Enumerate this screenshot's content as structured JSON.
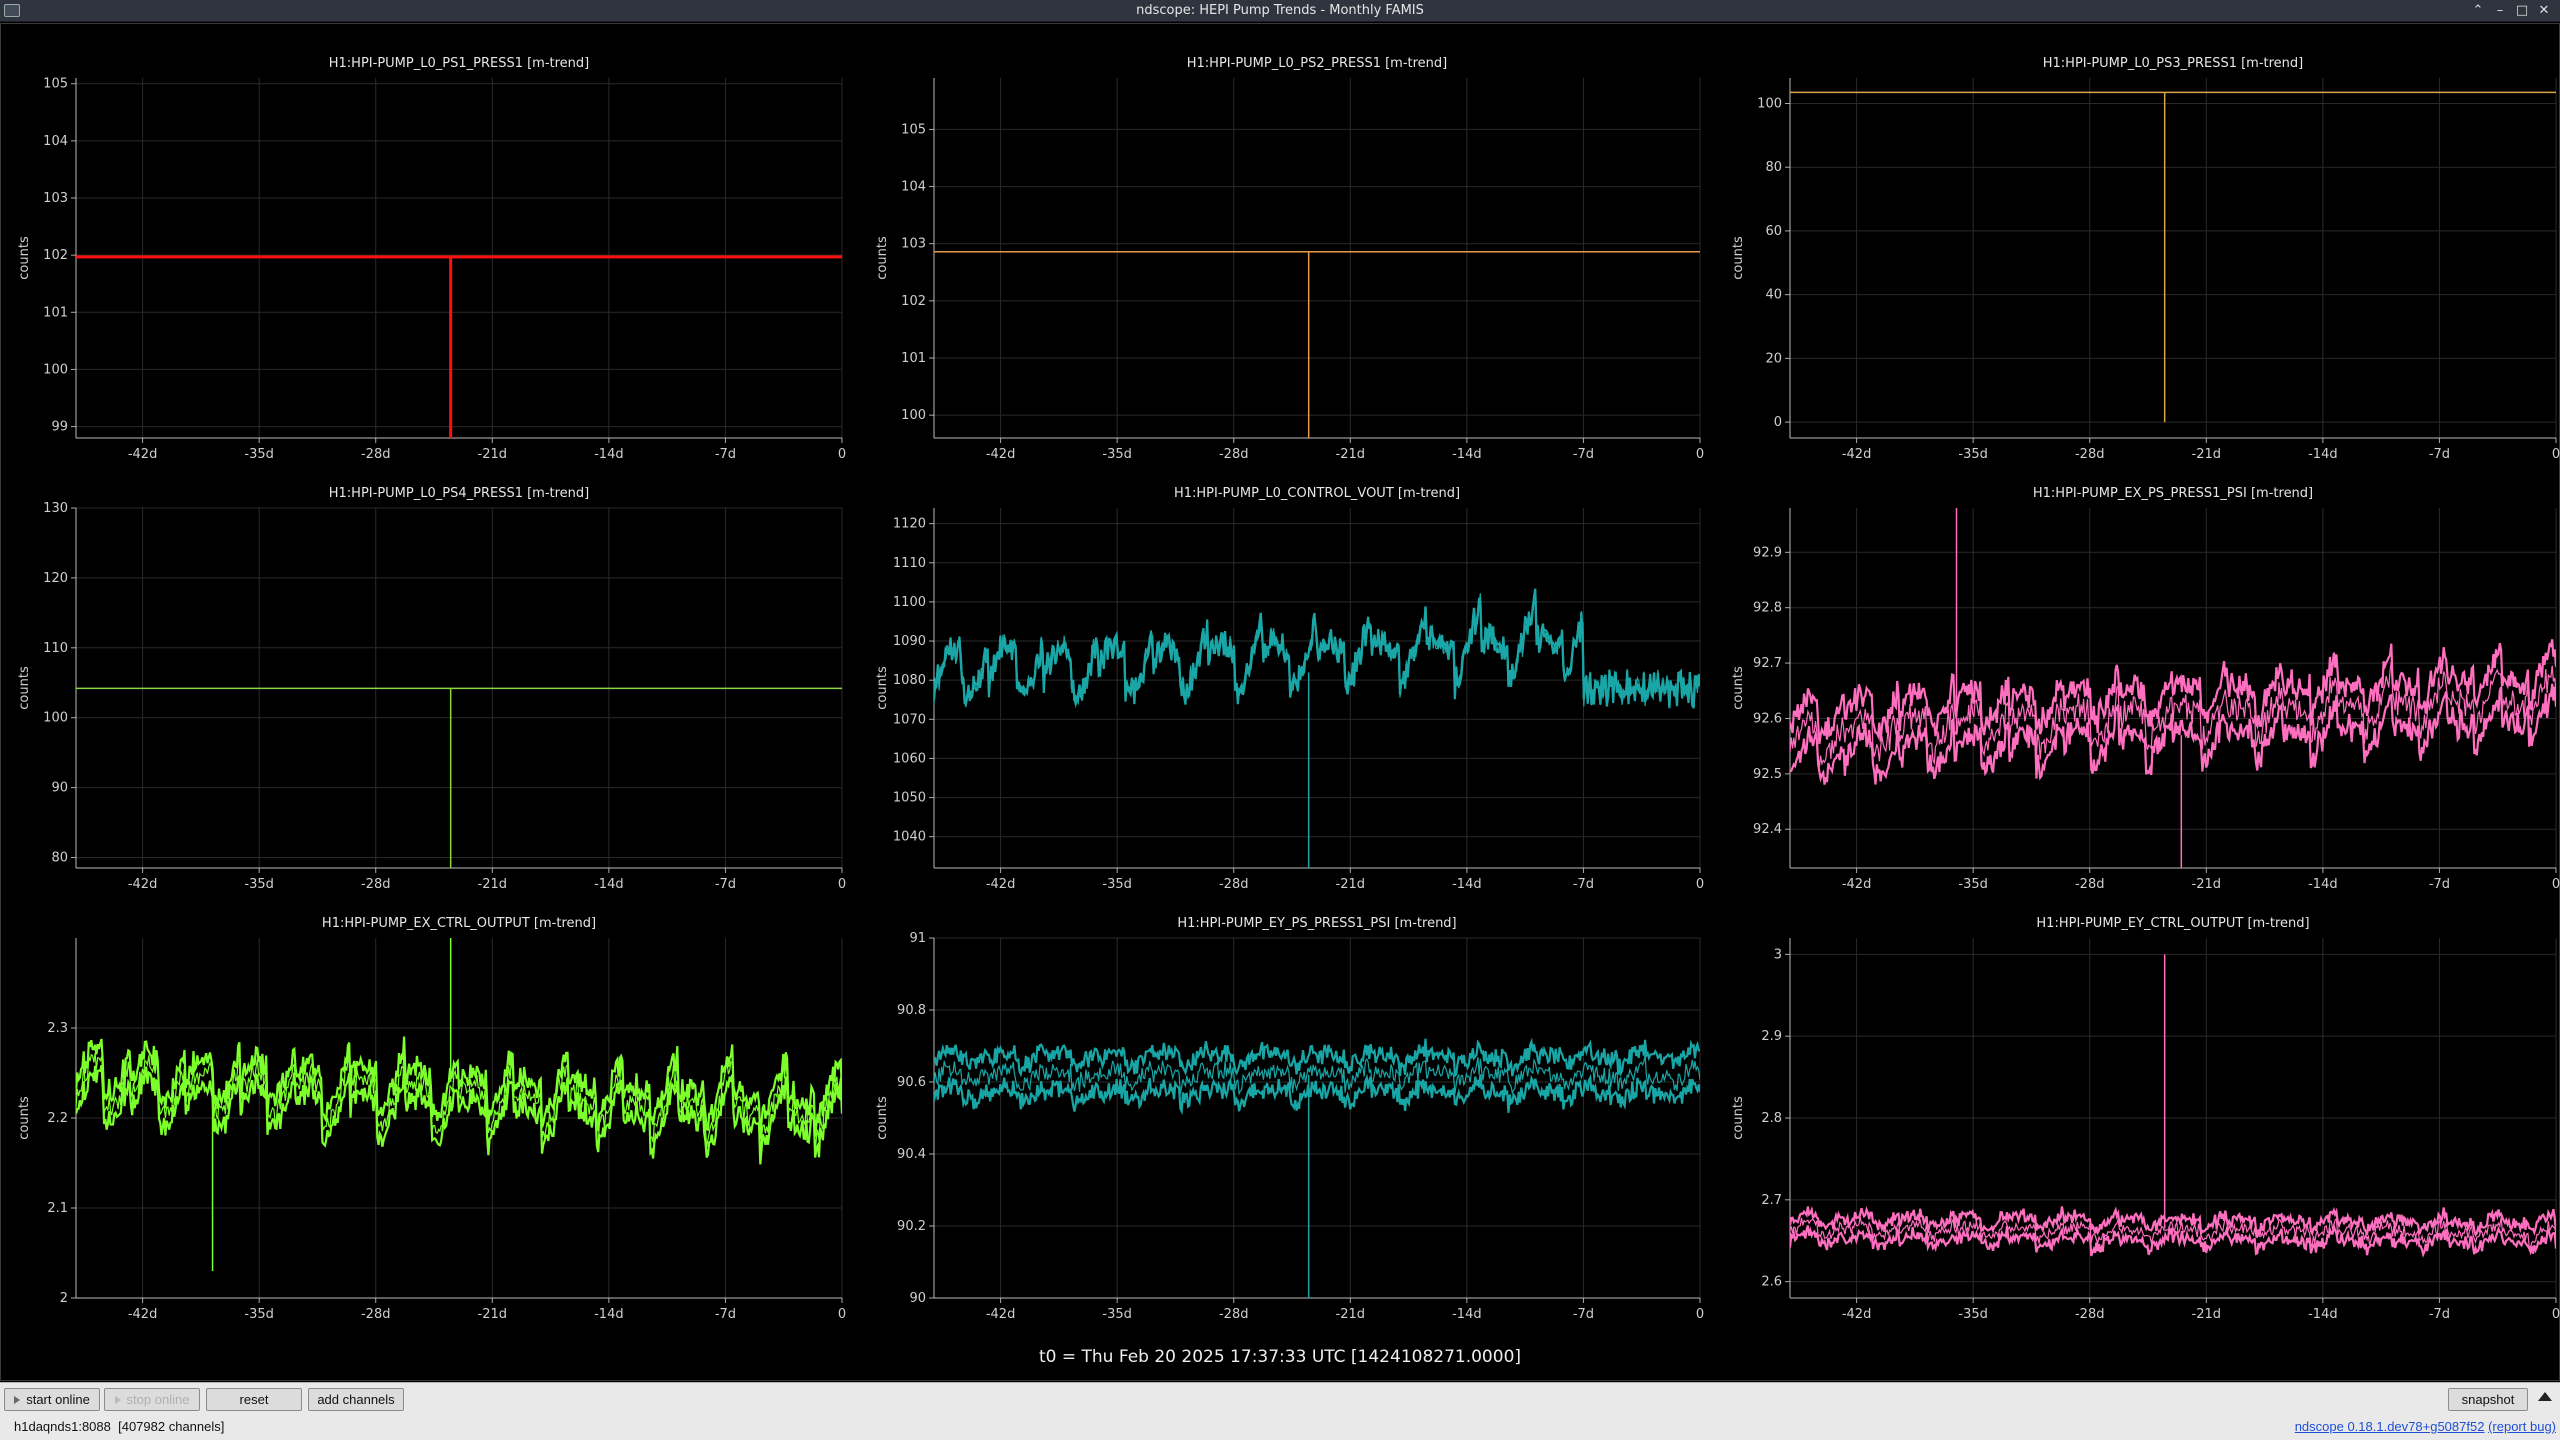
{
  "window": {
    "title": "ndscope: HEPI Pump Trends - Monthly FAMIS"
  },
  "t0_label": "t0 = Thu Feb 20 2025 17:37:33 UTC [1424108271.0000]",
  "controls": {
    "start_online": "start online",
    "stop_online": "stop online",
    "reset": "reset",
    "add_channels": "add channels",
    "snapshot": "snapshot"
  },
  "status": {
    "server": "h1daqnds1:8088",
    "channels": "[407982 channels]",
    "version": "ndscope 0.18.1.dev78+g5087f52",
    "report_bug": "(report bug)"
  },
  "chart_data": [
    {
      "type": "line",
      "title": "H1:HPI-PUMP_L0_PS1_PRESS1 [m-trend]",
      "ylabel": "counts",
      "xlim": [
        -46,
        0
      ],
      "ylim": [
        98.8,
        105.1
      ],
      "x_ticks": [
        "-42d",
        "-35d",
        "-28d",
        "-21d",
        "-14d",
        "-7d",
        "0"
      ],
      "y_ticks": [
        99,
        100,
        101,
        102,
        103,
        104,
        105
      ],
      "color": "#ff1010",
      "pattern": "flat",
      "level": 101.97,
      "dip_x": -23.5,
      "dip_to": 98.8
    },
    {
      "type": "line",
      "title": "H1:HPI-PUMP_L0_PS2_PRESS1 [m-trend]",
      "ylabel": "counts",
      "xlim": [
        -46,
        0
      ],
      "ylim": [
        99.6,
        105.9
      ],
      "x_ticks": [
        "-42d",
        "-35d",
        "-28d",
        "-21d",
        "-14d",
        "-7d",
        "0"
      ],
      "y_ticks": [
        100,
        101,
        102,
        103,
        104,
        105
      ],
      "color": "#e89a4a",
      "pattern": "flat",
      "level": 102.86,
      "dip_x": -23.5,
      "dip_to": 99.6
    },
    {
      "type": "line",
      "title": "H1:HPI-PUMP_L0_PS3_PRESS1 [m-trend]",
      "ylabel": "counts",
      "xlim": [
        -46,
        0
      ],
      "ylim": [
        -5,
        108
      ],
      "x_ticks": [
        "-42d",
        "-35d",
        "-28d",
        "-21d",
        "-14d",
        "-7d",
        "0"
      ],
      "y_ticks": [
        0,
        20,
        40,
        60,
        80,
        100
      ],
      "color": "#d9a64c",
      "pattern": "flat",
      "level": 103.5,
      "dip_x": -23.5,
      "dip_to": 0
    },
    {
      "type": "line",
      "title": "H1:HPI-PUMP_L0_PS4_PRESS1 [m-trend]",
      "ylabel": "counts",
      "xlim": [
        -46,
        0
      ],
      "ylim": [
        78.5,
        130
      ],
      "x_ticks": [
        "-42d",
        "-35d",
        "-28d",
        "-21d",
        "-14d",
        "-7d",
        "0"
      ],
      "y_ticks": [
        80,
        90,
        100,
        110,
        120,
        130
      ],
      "color": "#8ed63f",
      "pattern": "flat",
      "level": 104.2,
      "dip_x": -23.5,
      "dip_to": 78.5
    },
    {
      "type": "line",
      "title": "H1:HPI-PUMP_L0_CONTROL_VOUT [m-trend]",
      "ylabel": "counts",
      "xlim": [
        -46,
        0
      ],
      "ylim": [
        1032,
        1124
      ],
      "x_ticks": [
        "-42d",
        "-35d",
        "-28d",
        "-21d",
        "-14d",
        "-7d",
        "0"
      ],
      "y_ticks": [
        1040,
        1050,
        1060,
        1070,
        1080,
        1090,
        1100,
        1110,
        1120
      ],
      "color": "#1aa6a6",
      "pattern": "noisy",
      "base": 1082,
      "amp": 10,
      "spread": 3,
      "trend": 10,
      "drop_at": -7,
      "drop_to": 1078,
      "dip_x": -23.5,
      "dip_to": 1032,
      "band_offset": 0
    },
    {
      "type": "line",
      "title": "H1:HPI-PUMP_EX_PS_PRESS1_PSI [m-trend]",
      "ylabel": "counts",
      "xlim": [
        -46,
        0
      ],
      "ylim": [
        92.33,
        92.98
      ],
      "x_ticks": [
        "-42d",
        "-35d",
        "-28d",
        "-21d",
        "-14d",
        "-7d",
        "0"
      ],
      "y_ticks": [
        92.4,
        92.5,
        92.6,
        92.7,
        92.8,
        92.9
      ],
      "color": "#ff6fbf",
      "pattern": "noisy",
      "base": 92.57,
      "amp": 0.05,
      "spread": 0.035,
      "trend": 0.07,
      "dip_x": -22.5,
      "dip_to": 92.33,
      "spike_x": -36,
      "spike_to": 92.98,
      "band_offset": 0.04
    },
    {
      "type": "line",
      "title": "H1:HPI-PUMP_EX_CTRL_OUTPUT [m-trend]",
      "ylabel": "counts",
      "xlim": [
        -46,
        0
      ],
      "ylim": [
        2.0,
        2.4
      ],
      "x_ticks": [
        "-42d",
        "-35d",
        "-28d",
        "-21d",
        "-14d",
        "-7d",
        "0"
      ],
      "y_ticks": [
        2.0,
        2.1,
        2.2,
        2.3
      ],
      "color": "#7cff2b",
      "pattern": "noisy",
      "base": 2.24,
      "amp": 0.04,
      "spread": 0.012,
      "trend": -0.03,
      "dip_x": -37.8,
      "dip_to": 2.03,
      "spike_x": -23.5,
      "spike_to": 2.4,
      "band_offset": 0.015
    },
    {
      "type": "line",
      "title": "H1:HPI-PUMP_EY_PS_PRESS1_PSI [m-trend]",
      "ylabel": "counts",
      "xlim": [
        -46,
        0
      ],
      "ylim": [
        90.0,
        91.0
      ],
      "x_ticks": [
        "-42d",
        "-35d",
        "-28d",
        "-21d",
        "-14d",
        "-7d",
        "0"
      ],
      "y_ticks": [
        90.0,
        90.2,
        90.4,
        90.6,
        90.8,
        91.0
      ],
      "color": "#18a5a5",
      "pattern": "noisy",
      "base": 90.62,
      "amp": 0.03,
      "spread": 0.045,
      "trend": 0.0,
      "dip_x": -23.5,
      "dip_to": 90.0,
      "band_offset": 0.05
    },
    {
      "type": "line",
      "title": "H1:HPI-PUMP_EY_CTRL_OUTPUT [m-trend]",
      "ylabel": "counts",
      "xlim": [
        -46,
        0
      ],
      "ylim": [
        2.58,
        3.02
      ],
      "x_ticks": [
        "-42d",
        "-35d",
        "-28d",
        "-21d",
        "-14d",
        "-7d",
        "0"
      ],
      "y_ticks": [
        2.6,
        2.7,
        2.8,
        2.9,
        3.0
      ],
      "color": "#ff6fbf",
      "pattern": "noisy",
      "base": 2.665,
      "amp": 0.012,
      "spread": 0.012,
      "trend": -0.005,
      "spike_x": -23.5,
      "spike_to": 3.0,
      "band_offset": 0.012
    }
  ]
}
